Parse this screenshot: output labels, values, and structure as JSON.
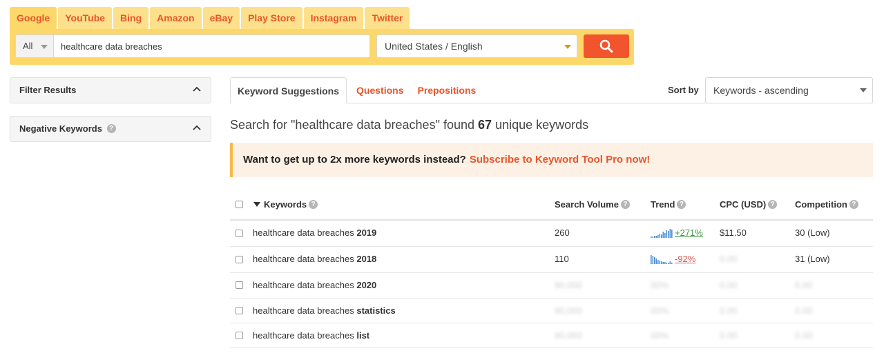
{
  "engines": [
    "Google",
    "YouTube",
    "Bing",
    "Amazon",
    "eBay",
    "Play Store",
    "Instagram",
    "Twitter"
  ],
  "search": {
    "scope": "All",
    "query": "healthcare data breaches",
    "locale": "United States / English"
  },
  "filters": {
    "filter_results": "Filter Results",
    "negative_keywords": "Negative Keywords"
  },
  "result_tabs": [
    "Keyword Suggestions",
    "Questions",
    "Prepositions"
  ],
  "sort": {
    "label": "Sort by",
    "value": "Keywords - ascending"
  },
  "summary": {
    "prefix": "Search for \"healthcare data breaches\" found",
    "count": "67",
    "suffix": "unique keywords"
  },
  "promo": {
    "text": "Want to get up to 2x more keywords instead?",
    "link": "Subscribe to Keyword Tool Pro now!"
  },
  "columns": {
    "keywords": "Keywords",
    "search_volume": "Search Volume",
    "trend": "Trend",
    "cpc": "CPC (USD)",
    "competition": "Competition"
  },
  "rows": [
    {
      "base": "healthcare data breaches",
      "suffix": "2019",
      "volume": "260",
      "trend": "+271%",
      "trend_dir": "up",
      "cpc": "$11.50",
      "competition": "30 (Low)"
    },
    {
      "base": "healthcare data breaches",
      "suffix": "2018",
      "volume": "110",
      "trend": "-92%",
      "trend_dir": "down",
      "cpc": "0.00",
      "competition": "31 (Low)"
    },
    {
      "base": "healthcare data breaches",
      "suffix": "2020",
      "volume": "90,000",
      "trend": "00%",
      "cpc": "0.00",
      "competition": "0.00"
    },
    {
      "base": "healthcare data breaches",
      "suffix": "statistics",
      "volume": "90,000",
      "trend": "00%",
      "cpc": "0.00",
      "competition": "0.00"
    },
    {
      "base": "healthcare data breaches",
      "suffix": "list",
      "volume": "90,000",
      "trend": "00%",
      "cpc": "0.00",
      "competition": "0.00"
    }
  ],
  "colors": {
    "accent": "#e8552a",
    "tab_bg": "#fde08b",
    "search_btn": "#f2542d",
    "trend_up": "#3a9a3a",
    "trend_down": "#d9534f"
  }
}
